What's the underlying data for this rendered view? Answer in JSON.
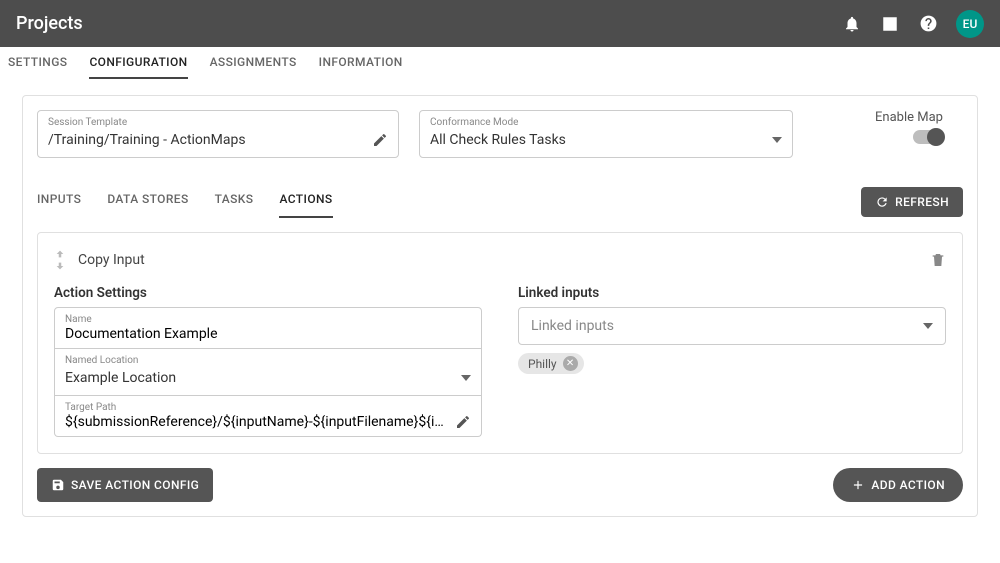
{
  "topbar": {
    "title": "Projects",
    "avatar": "EU"
  },
  "main_tabs": [
    {
      "label": "SETTINGS",
      "active": false
    },
    {
      "label": "CONFIGURATION",
      "active": true
    },
    {
      "label": "ASSIGNMENTS",
      "active": false
    },
    {
      "label": "INFORMATION",
      "active": false
    }
  ],
  "session_template": {
    "label": "Session Template",
    "value": "/Training/Training - ActionMaps"
  },
  "conformance_mode": {
    "label": "Conformance Mode",
    "value": "All Check Rules Tasks"
  },
  "enable_map": {
    "label": "Enable Map"
  },
  "sub_tabs": [
    {
      "label": "INPUTS",
      "active": false
    },
    {
      "label": "DATA STORES",
      "active": false
    },
    {
      "label": "TASKS",
      "active": false
    },
    {
      "label": "ACTIONS",
      "active": true
    }
  ],
  "refresh_label": "REFRESH",
  "action": {
    "title": "Copy Input",
    "settings_title": "Action Settings",
    "name_label": "Name",
    "name_value": "Documentation Example",
    "named_location_label": "Named Location",
    "named_location_value": "Example Location",
    "target_path_label": "Target Path",
    "target_path_value": "${submissionReference}/${inputName}-${inputFilename}${inputFileE",
    "linked_title": "Linked inputs",
    "linked_placeholder": "Linked inputs",
    "chips": [
      "Philly"
    ]
  },
  "save_label": "SAVE ACTION CONFIG",
  "add_label": "ADD ACTION"
}
